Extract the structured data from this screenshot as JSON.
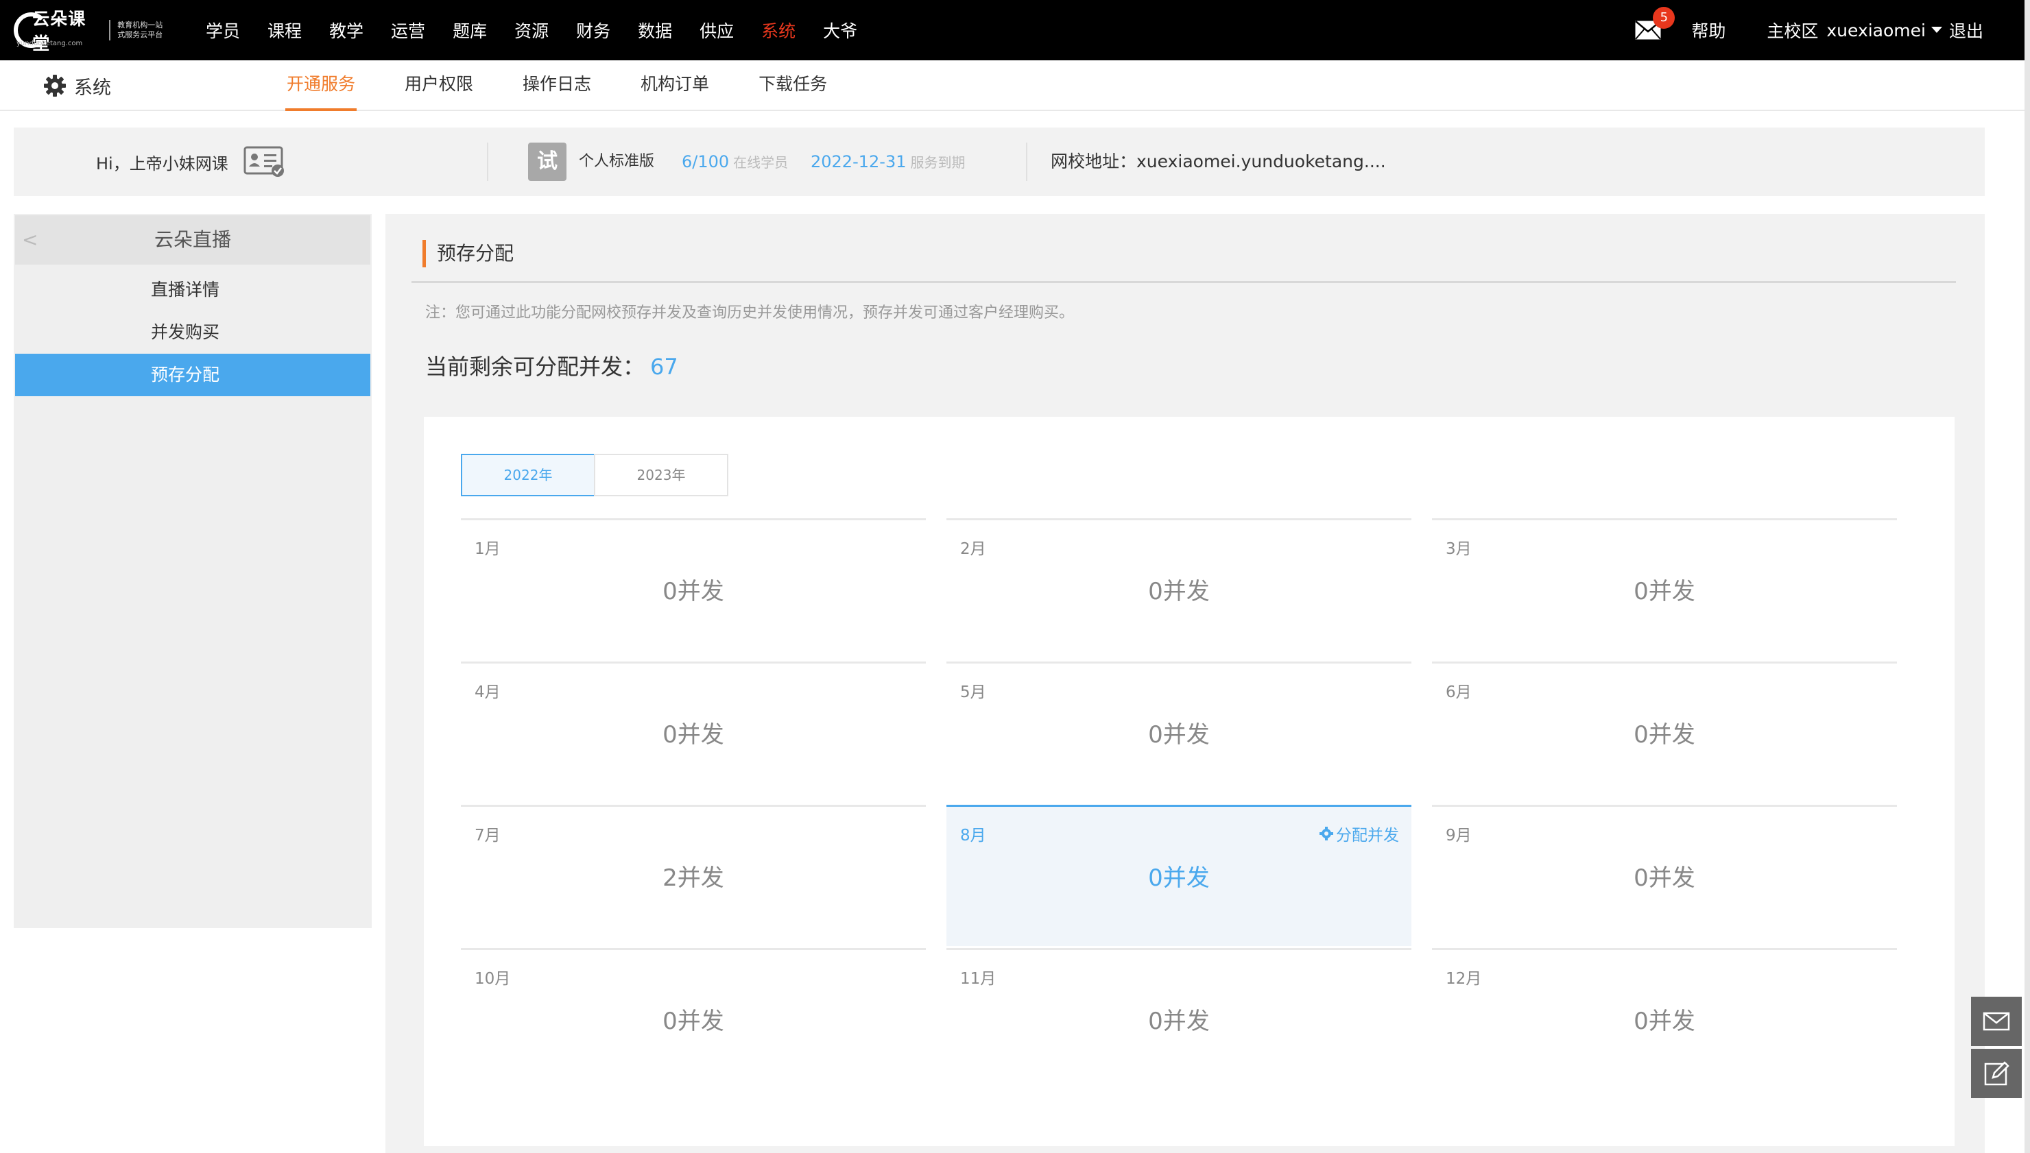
{
  "brand": {
    "name": "云朵课堂",
    "domain": "yunduoketang.com",
    "slogan_line1": "教育机构一站",
    "slogan_line2": "式服务云平台"
  },
  "top_nav": {
    "items": [
      "学员",
      "课程",
      "教学",
      "运营",
      "题库",
      "资源",
      "财务",
      "数据",
      "供应",
      "系统",
      "大爷"
    ],
    "active_index": 9,
    "mail_count": "5",
    "help": "帮助",
    "campus": "主校区",
    "user": "xuexiaomei",
    "logout": "退出"
  },
  "sub_nav": {
    "section_title": "系统",
    "tabs": [
      "开通服务",
      "用户权限",
      "操作日志",
      "机构订单",
      "下载任务"
    ],
    "active_index": 0
  },
  "info_bar": {
    "greeting": "Hi，上帝小妹网课",
    "trial_badge": "试",
    "plan": "个人标准版",
    "online_count": "6/100",
    "online_label": "在线学员",
    "expire_date": "2022-12-31",
    "expire_label": "服务到期",
    "site_label": "网校地址：",
    "site_url": "xuexiaomei.yunduoketang...."
  },
  "left_panel": {
    "title": "云朵直播",
    "back": "<",
    "items": [
      "直播详情",
      "并发购买",
      "预存分配"
    ],
    "active_index": 2
  },
  "main": {
    "section_title": "预存分配",
    "note": "注：您可通过此功能分配网校预存并发及查询历史并发使用情况，预存并发可通过客户经理购买。",
    "remaining_label": "当前剩余可分配并发：",
    "remaining_value": "67",
    "years": [
      "2022年",
      "2023年"
    ],
    "active_year_index": 0,
    "months": [
      {
        "label": "1月",
        "value": "0并发"
      },
      {
        "label": "2月",
        "value": "0并发"
      },
      {
        "label": "3月",
        "value": "0并发"
      },
      {
        "label": "4月",
        "value": "0并发"
      },
      {
        "label": "5月",
        "value": "0并发"
      },
      {
        "label": "6月",
        "value": "0并发"
      },
      {
        "label": "7月",
        "value": "2并发"
      },
      {
        "label": "8月",
        "value": "0并发",
        "highlighted": true,
        "action": "分配并发"
      },
      {
        "label": "9月",
        "value": "0并发"
      },
      {
        "label": "10月",
        "value": "0并发"
      },
      {
        "label": "11月",
        "value": "0并发"
      },
      {
        "label": "12月",
        "value": "0并发"
      }
    ]
  },
  "icons": {
    "mail": "mail-icon",
    "gear": "gear-icon",
    "id_card": "id-card-icon",
    "float_mail": "envelope-icon",
    "float_edit": "edit-icon"
  },
  "colors": {
    "accent_orange": "#f07c2c",
    "accent_blue": "#4aa8ed",
    "nav_active_red": "#e8371d"
  }
}
